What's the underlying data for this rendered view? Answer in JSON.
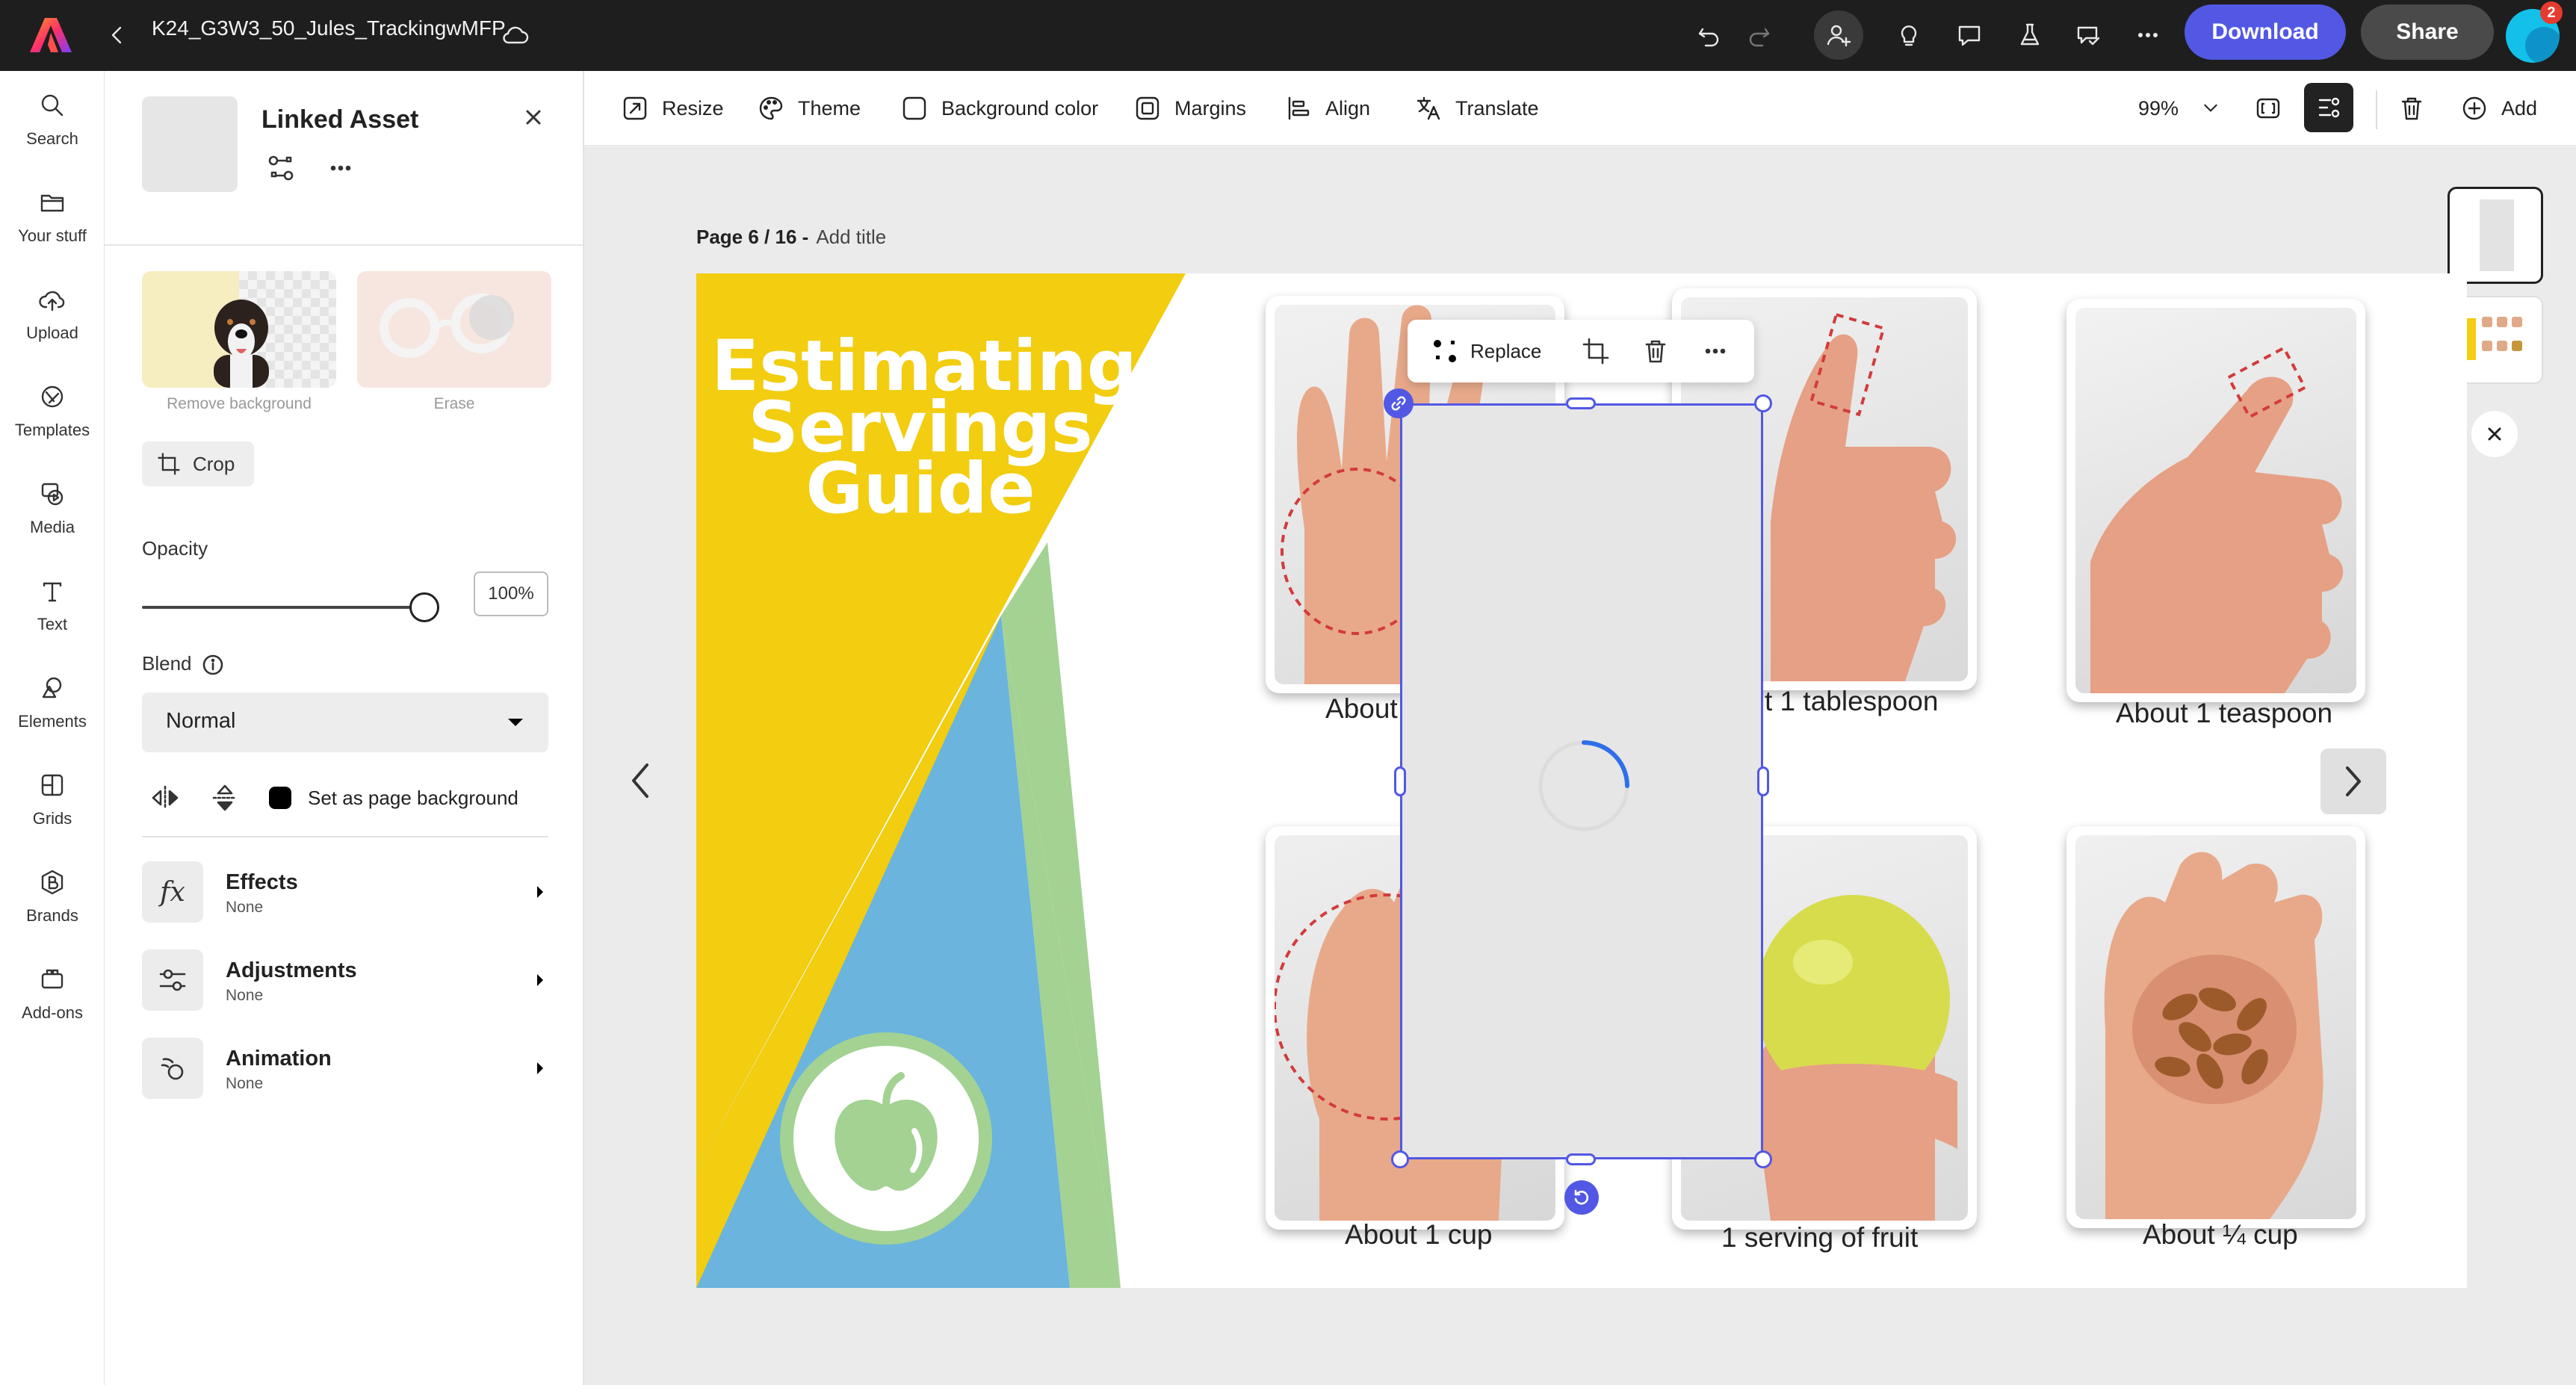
{
  "topbar": {
    "doc_title": "K24_G3W3_50_Jules_TrackingwMFP",
    "download_label": "Download",
    "share_label": "Share",
    "notification_count": "2"
  },
  "rail": {
    "items": [
      {
        "label": "Search",
        "icon": "search-icon"
      },
      {
        "label": "Your stuff",
        "icon": "folder-icon"
      },
      {
        "label": "Upload",
        "icon": "upload-icon"
      },
      {
        "label": "Templates",
        "icon": "templates-icon"
      },
      {
        "label": "Media",
        "icon": "media-icon"
      },
      {
        "label": "Text",
        "icon": "text-icon"
      },
      {
        "label": "Elements",
        "icon": "elements-icon"
      },
      {
        "label": "Grids",
        "icon": "grids-icon"
      },
      {
        "label": "Brands",
        "icon": "brands-icon"
      },
      {
        "label": "Add-ons",
        "icon": "addons-icon"
      }
    ]
  },
  "panel": {
    "title": "Linked Asset",
    "quick_actions": [
      {
        "label": "Remove background"
      },
      {
        "label": "Erase"
      }
    ],
    "crop_label": "Crop",
    "opacity_label": "Opacity",
    "opacity_value": "100%",
    "opacity_fraction": 1.0,
    "blend_label": "Blend",
    "blend_value": "Normal",
    "page_bg_label": "Set as page background",
    "sections": [
      {
        "title": "Effects",
        "sub": "None",
        "icon": "fx-icon"
      },
      {
        "title": "Adjustments",
        "sub": "None",
        "icon": "sliders-icon"
      },
      {
        "title": "Animation",
        "sub": "None",
        "icon": "animation-icon"
      }
    ]
  },
  "toolbar": {
    "resize": "Resize",
    "theme": "Theme",
    "background_color": "Background color",
    "margins": "Margins",
    "align": "Align",
    "translate": "Translate",
    "zoom": "99%",
    "add": "Add"
  },
  "canvas": {
    "page_label": "Page 6 / 16 -",
    "add_title": "Add title",
    "page_title_lines": [
      "Estimating",
      "Servings",
      "Guide"
    ],
    "captions": [
      "About",
      "t 1 tablespoon",
      "About 1 teaspoon",
      "About 1 cup",
      "1 serving of fruit",
      "About ¼ cup"
    ],
    "float_replace": "Replace"
  },
  "colors": {
    "accent": "#5258e4",
    "yellow": "#f2cd10",
    "blue": "#6ab4de",
    "green": "#a3d293"
  }
}
